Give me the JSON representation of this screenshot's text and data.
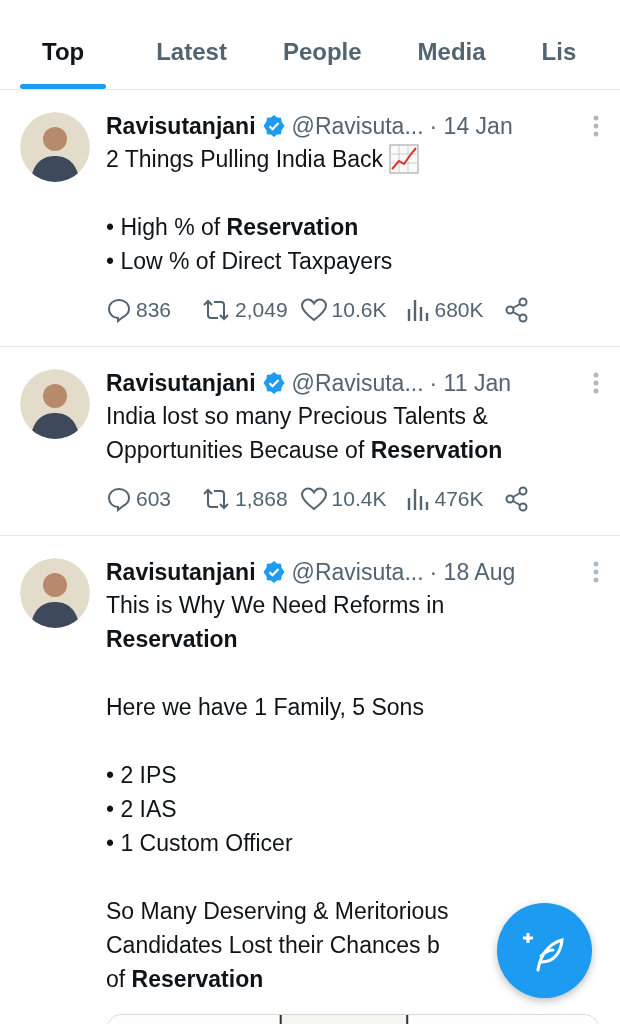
{
  "tabs": [
    {
      "label": "Top",
      "selected": true
    },
    {
      "label": "Latest",
      "selected": false
    },
    {
      "label": "People",
      "selected": false
    },
    {
      "label": "Media",
      "selected": false
    },
    {
      "label": "Lis",
      "selected": false
    }
  ],
  "posts": [
    {
      "name": "Ravisutanjani",
      "verified": true,
      "handle": "@Ravisuta...",
      "date": "· 14 Jan",
      "paragraphs": [
        [
          {
            "text": "2 Things Pulling India Back",
            "kind": "chart"
          }
        ],
        [
          "• High % of **Reservation**",
          "• Low % of Direct Taxpayers"
        ]
      ],
      "stats": {
        "replies": "836",
        "reposts": "2,049",
        "likes": "10.6K",
        "views": "680K"
      }
    },
    {
      "name": "Ravisutanjani",
      "verified": true,
      "handle": "@Ravisuta...",
      "date": "· 11 Jan",
      "paragraphs": [
        [
          "India lost so many Precious Talents &",
          "Opportunities Because of **Reservation**"
        ]
      ],
      "stats": {
        "replies": "603",
        "reposts": "1,868",
        "likes": "10.4K",
        "views": "476K"
      }
    },
    {
      "name": "Ravisutanjani",
      "verified": true,
      "handle": "@Ravisuta...",
      "date": "· 18 Aug",
      "paragraphs": [
        [
          "This is Why We Need Reforms in",
          "**Reservation**"
        ],
        [
          "Here we have 1 Family, 5 Sons"
        ],
        [
          "• 2 IPS",
          "• 2 IAS",
          "• 1 Custom Officer"
        ],
        [
          "So Many Deserving & Meritorious",
          "Candidates Lost their Chances b",
          "of **Reservation**"
        ]
      ],
      "media": {
        "kind": "picture"
      }
    }
  ]
}
